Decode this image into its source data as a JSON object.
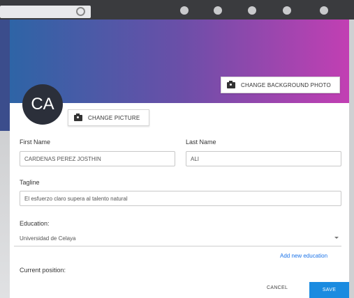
{
  "colors": {
    "cover_gradient": [
      "#2e64a6",
      "#6a4fa8",
      "#c23fb3"
    ],
    "primary": "#1a8be0",
    "link": "#1a73e8"
  },
  "profile": {
    "avatar_initials": "CA",
    "change_background_label": "CHANGE BACKGROUND PHOTO",
    "change_picture_label": "CHANGE PICTURE",
    "camera_icon": "camera-icon"
  },
  "form": {
    "first_name_label": "First Name",
    "first_name_value": "CARDENAS PEREZ JOSTHIN",
    "last_name_label": "Last Name",
    "last_name_value": "ALI",
    "tagline_label": "Tagline",
    "tagline_value": "El esfuerzo claro supera al talento natural",
    "education_label": "Education:",
    "education_value": "Universidad de Celaya",
    "add_education_label": "Add new education",
    "current_position_label": "Current position:"
  },
  "actions": {
    "cancel_label": "CANCEL",
    "save_label": "SAVE"
  }
}
